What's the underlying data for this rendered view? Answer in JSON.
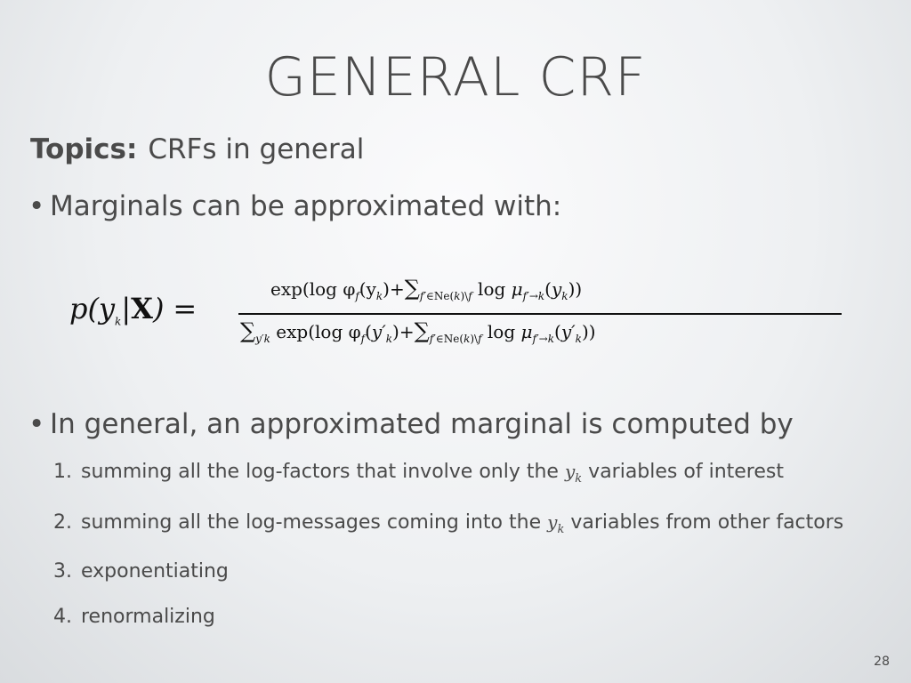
{
  "title": "GENERAL CRF",
  "topics": {
    "label": "Topics:",
    "text": "CRFs in general"
  },
  "bullets": [
    {
      "dot": "•",
      "text": "Marginals can be approximated with:"
    },
    {
      "dot": "•",
      "text": "In general, an approximated marginal is computed by"
    }
  ],
  "steps": [
    {
      "num": "1.",
      "before": "summing all the log-factors that involve only the",
      "var": "y",
      "sub": "k",
      "after": "variables of interest"
    },
    {
      "num": "2.",
      "before": "summing all the log-messages coming into the",
      "var": "y",
      "sub": "k",
      "after": "variables from other factors"
    },
    {
      "num": "3.",
      "before": "exponentiating"
    },
    {
      "num": "4.",
      "before": "renormalizing"
    }
  ],
  "formula": {
    "lhs_p": "p(y",
    "lhs_sub": "k",
    "lhs_mid": "|",
    "lhs_X": "X",
    "lhs_close": ")",
    "eq": "=",
    "numerator": "exp(log φ",
    "numerator_rest": "(y",
    "denominator_sum": "∑",
    "denominator_sum_sub": "y′",
    "denominator_rest": "exp(log φ"
  },
  "page_number": "28"
}
